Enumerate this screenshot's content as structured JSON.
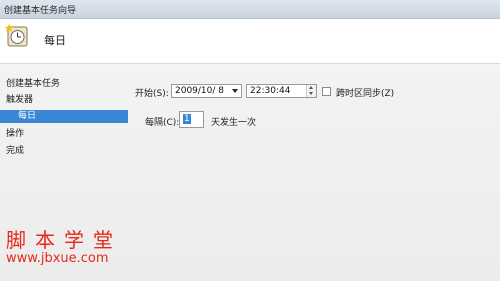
{
  "window": {
    "title": "创建基本任务向导"
  },
  "header": {
    "icon": "clock-icon",
    "title": "每日"
  },
  "nav": {
    "items": [
      {
        "label": "创建基本任务",
        "selected": false
      },
      {
        "label": "触发器",
        "selected": false
      },
      {
        "label": "每日",
        "selected": true
      },
      {
        "label": "操作",
        "selected": false
      },
      {
        "label": "完成",
        "selected": false
      }
    ]
  },
  "trigger": {
    "start_label": "开始(S):",
    "start_date": "2009/10/ 8",
    "start_time": "22:30:44",
    "sync_label": "跨时区同步(Z)",
    "sync_checked": false,
    "recur_label": "每隔(C):",
    "recur_value": "1",
    "recur_suffix": "天发生一次"
  },
  "watermark": {
    "line1": "脚本学堂",
    "line2": "www.jbxue.com"
  },
  "colors": {
    "selection": "#3a86d6",
    "watermark": "#e8281a"
  }
}
